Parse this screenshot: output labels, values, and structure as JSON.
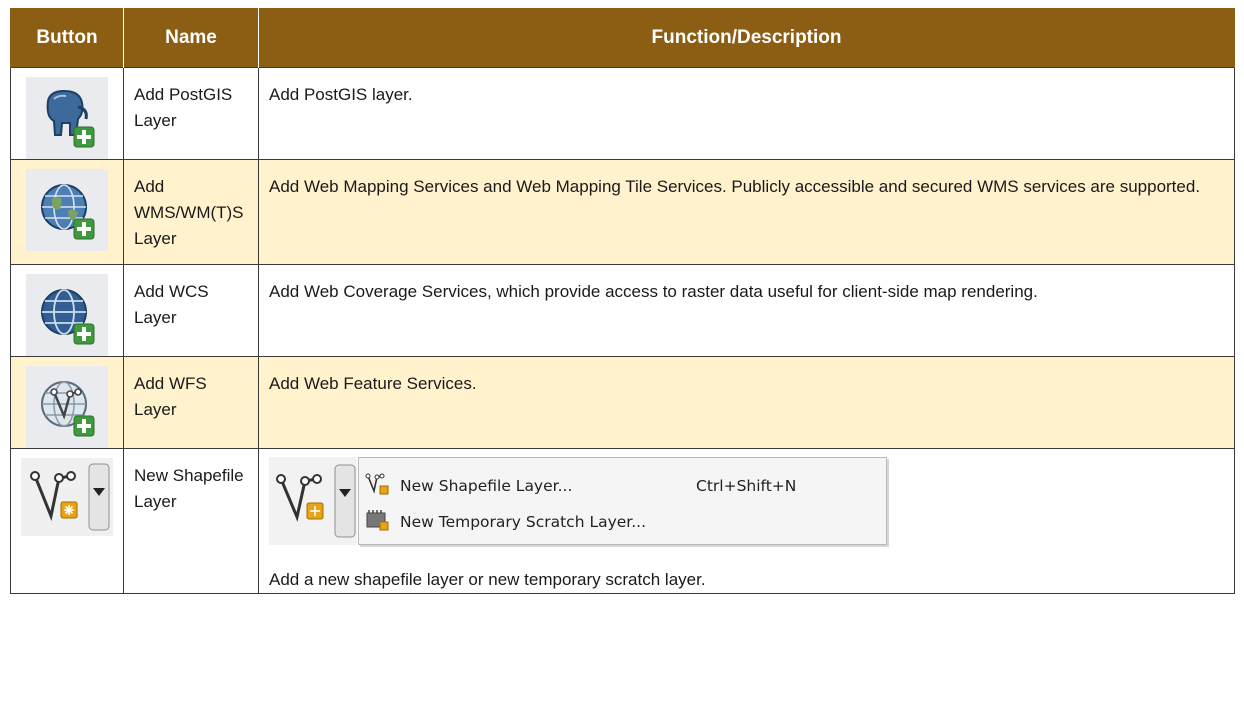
{
  "table": {
    "headers": [
      "Button",
      "Name",
      "Function/Description"
    ],
    "rows": [
      {
        "name": "Add PostGIS Layer",
        "description": "Add PostGIS layer.",
        "icon": "postgis-elephant-add-icon"
      },
      {
        "name": "Add WMS/WM(T)S Layer",
        "description": "Add Web Mapping Services and Web Mapping Tile Services. Publicly accessible and secured WMS services are supported.",
        "icon": "wms-globe-add-icon"
      },
      {
        "name": "Add WCS Layer",
        "description": "Add Web Coverage Services, which provide access to raster data useful for client-side map rendering.",
        "icon": "wcs-globe-add-icon"
      },
      {
        "name": "Add WFS Layer",
        "description": "Add Web Feature Services.",
        "icon": "wfs-globe-vector-add-icon"
      },
      {
        "name": "New Shapefile Layer",
        "description": "Add a new shapefile layer or new temporary scratch layer.",
        "icon": "new-shapefile-vector-icon"
      }
    ]
  },
  "dropdown_menu": {
    "items": [
      {
        "label": "New Shapefile Layer...",
        "shortcut": "Ctrl+Shift+N",
        "icon": "new-shapefile-icon"
      },
      {
        "label": "New Temporary Scratch Layer...",
        "shortcut": "",
        "icon": "scratch-layer-icon"
      }
    ]
  },
  "colors": {
    "header_bg": "#8c5e14",
    "header_text": "#ffffff",
    "shaded_row": "#fff2cc",
    "icon_bg": "#e9ebee",
    "add_badge": "#3f9a3f"
  }
}
